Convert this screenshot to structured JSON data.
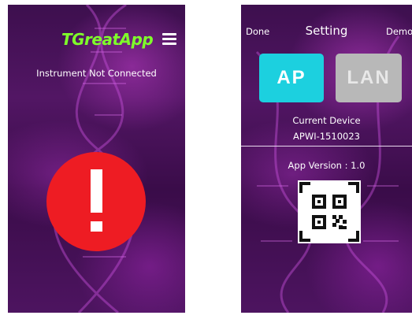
{
  "left_screen": {
    "app_title": "TGreatApp",
    "menu_icon": "hamburger-menu-icon",
    "status": "Instrument Not Connected",
    "alert_icon": "exclamation-alert-icon"
  },
  "right_screen": {
    "nav": {
      "done_label": "Done",
      "title": "Setting",
      "demo_label": "Demo"
    },
    "mode_buttons": {
      "ap_label": "AP",
      "lan_label": "LAN"
    },
    "current_device_label": "Current Device",
    "current_device_value": "APWI-1510023",
    "app_version": "App Version : 1.0",
    "qr_icon": "qr-code-scanner-icon"
  },
  "colors": {
    "background": "#4a1258",
    "app_title": "#7fff2a",
    "alert": "#ee1c23",
    "ap_active": "#1cd0df",
    "lan_inactive": "#b8b8b8"
  }
}
